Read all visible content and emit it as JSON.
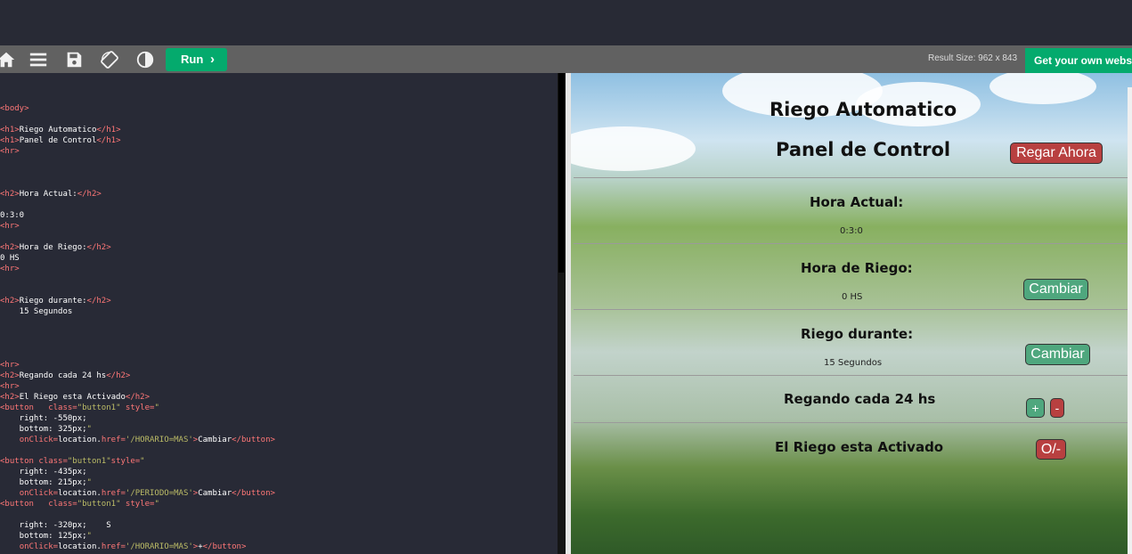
{
  "toolbar": {
    "icons": [
      "home-icon",
      "menu-icon",
      "save-icon",
      "rotate-icon",
      "contrast-icon"
    ],
    "run_label": "Run",
    "result_size": "Result Size: 962 x 843",
    "get_website": "Get your own website"
  },
  "code_lines": [
    {
      "row": 0,
      "html": "&lt;body&gt;"
    },
    {
      "row": 2,
      "html": "&lt;h1&gt;Riego Automatico&lt;/h1&gt;"
    },
    {
      "row": 3,
      "html": "&lt;h1&gt;Panel de Control&lt;/h1&gt;"
    },
    {
      "row": 4,
      "html": "&lt;hr&gt;"
    },
    {
      "row": 8,
      "html": "&lt;h2&gt;Hora Actual:&lt;/h2&gt;"
    },
    {
      "row": 10,
      "html": "0:3:0"
    },
    {
      "row": 11,
      "html": "&lt;hr&gt;"
    },
    {
      "row": 13,
      "html": "&lt;h2&gt;Hora de Riego:&lt;/h2&gt;"
    },
    {
      "row": 14,
      "html": "0 HS"
    },
    {
      "row": 15,
      "html": "&lt;hr&gt;"
    },
    {
      "row": 18,
      "html": "&lt;h2&gt;Riego durante:&lt;/h2&gt;"
    },
    {
      "row": 19,
      "html": "    15 Segundos"
    },
    {
      "row": 24,
      "html": "&lt;hr&gt;"
    },
    {
      "row": 25,
      "html": "&lt;h2&gt;Regando cada 24 hs&lt;/h2&gt;"
    },
    {
      "row": 26,
      "html": "&lt;hr&gt;"
    },
    {
      "row": 27,
      "html": "&lt;h2&gt;El Riego esta Activado&lt;/h2&gt;"
    },
    {
      "row": 28,
      "html": "&lt;button   class=\"button1\" style=\""
    },
    {
      "row": 29,
      "html": "    right: -550px;"
    },
    {
      "row": 30,
      "html": "    bottom: 325px;\""
    },
    {
      "row": 31,
      "html": "    onClick=location.href='/HORARIO=MAS'&gt;Cambiar&lt;/button&gt;"
    },
    {
      "row": 33,
      "html": "&lt;button class=\"button1\"style=\""
    },
    {
      "row": 34,
      "html": "    right: -435px;"
    },
    {
      "row": 35,
      "html": "    bottom: 215px;\""
    },
    {
      "row": 36,
      "html": "    onClick=location.href='/PERIODO=MAS'&gt;Cambiar&lt;/button&gt;"
    },
    {
      "row": 37,
      "html": "&lt;button   class=\"button1\" style=\""
    },
    {
      "row": 39,
      "html": "    right: -320px;    S"
    },
    {
      "row": 40,
      "html": "    bottom: 125px;\""
    },
    {
      "row": 41,
      "html": "    onClick=location.href='/HORARIO=MAS'&gt;+&lt;/button&gt;"
    }
  ],
  "result": {
    "title": "Riego Automatico",
    "subtitle": "Panel de Control",
    "regar_ahora": "Regar Ahora",
    "hora_actual_label": "Hora Actual:",
    "hora_actual_value": "0:3:0",
    "hora_riego_label": "Hora de Riego:",
    "hora_riego_value": "0 HS",
    "cambiar_1": "Cambiar",
    "riego_durante_label": "Riego durante:",
    "riego_durante_value": "15 Segundos",
    "cambiar_2": "Cambiar",
    "regando_label": "Regando cada 24 hs",
    "plus": "+",
    "minus": "-",
    "activado_label": "El Riego esta Activado",
    "toggle": "O/-"
  },
  "colors": {
    "run_green": "#04aa6d",
    "button_red": "#b84040",
    "button_green": "#4fa77e",
    "editor_bg": "#282a36"
  }
}
